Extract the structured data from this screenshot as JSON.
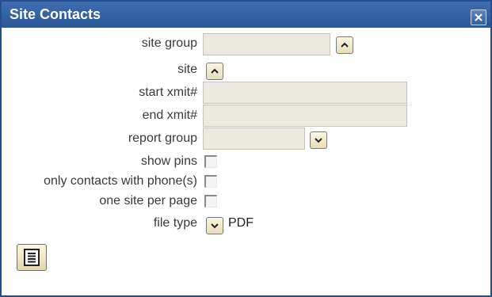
{
  "window": {
    "title": "Site Contacts"
  },
  "form": {
    "site_group_label": "site group",
    "site_group_value": "",
    "site_label": "site",
    "start_xmit_label": "start xmit#",
    "start_xmit_value": "",
    "end_xmit_label": "end xmit#",
    "end_xmit_value": "",
    "report_group_label": "report group",
    "report_group_value": "",
    "show_pins_label": "show pins",
    "show_pins_checked": false,
    "only_contacts_label": "only contacts with phone(s)",
    "only_contacts_checked": false,
    "one_site_label": "one site per page",
    "one_site_checked": false,
    "file_type_label": "file type",
    "file_type_value": "PDF"
  },
  "icons": {
    "close": "close-icon",
    "chevron_up": "chevron-up-icon",
    "chevron_down": "chevron-down-icon",
    "report": "document-list-icon"
  },
  "colors": {
    "titlebar": "#2b5797",
    "field_bg": "#ece9e0",
    "button_bg": "#f4eed2"
  }
}
